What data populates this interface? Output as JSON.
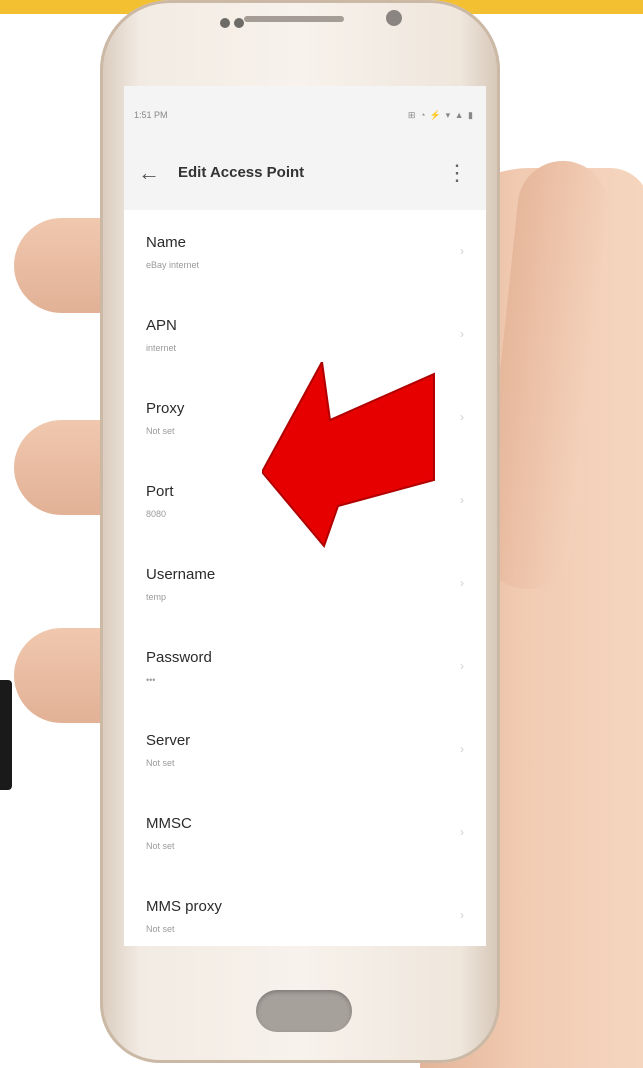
{
  "status_bar": {
    "time": "1:51 PM",
    "icons": "⊞ ◔ ⚡ ▾ ▲ ▮"
  },
  "header": {
    "title": "Edit Access Point"
  },
  "settings": [
    {
      "title": "Name",
      "value": "eBay internet"
    },
    {
      "title": "APN",
      "value": "internet"
    },
    {
      "title": "Proxy",
      "value": "Not set"
    },
    {
      "title": "Port",
      "value": "8080"
    },
    {
      "title": "Username",
      "value": "temp"
    },
    {
      "title": "Password",
      "value": "•••"
    },
    {
      "title": "Server",
      "value": "Not set"
    },
    {
      "title": "MMSC",
      "value": "Not set"
    },
    {
      "title": "MMS proxy",
      "value": "Not set"
    }
  ],
  "colors": {
    "arrow": "#e60000",
    "banner": "#f2c030"
  },
  "icons": {
    "back": "back-arrow-icon",
    "menu": "overflow-menu-icon"
  }
}
